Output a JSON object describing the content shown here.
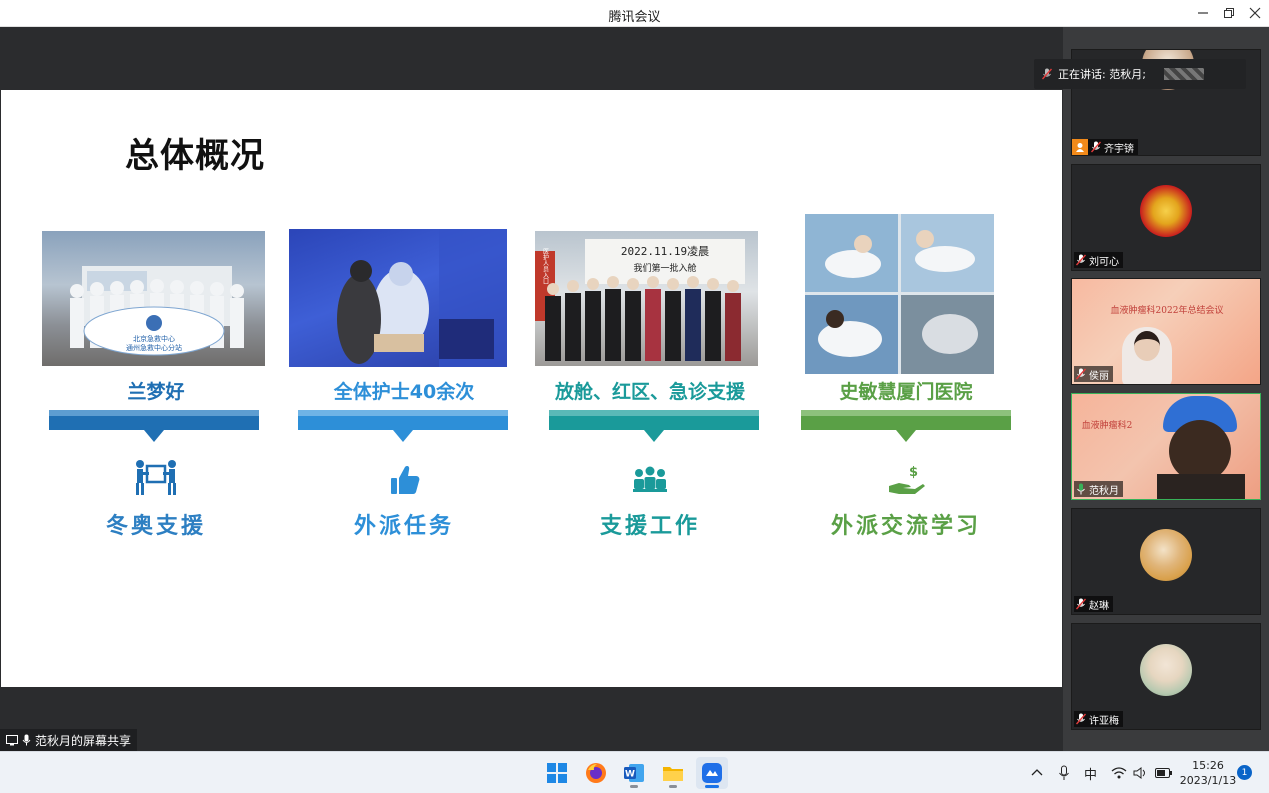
{
  "window": {
    "title": "腾讯会议"
  },
  "slide": {
    "title": "总体概况",
    "columns": [
      {
        "caption": "兰梦好",
        "subtitle": "冬奥支援",
        "color": "#1f6fb3",
        "icon": "people-carry-box-icon"
      },
      {
        "caption": "全体护士40余次",
        "subtitle": "外派任务",
        "color": "#2d8fd8",
        "icon": "thumbs-up-icon"
      },
      {
        "caption": "放舱、红区、急诊支援",
        "subtitle": "支援工作",
        "color": "#1a9a9a",
        "icon": "team-group-icon"
      },
      {
        "caption": "史敏慧厦门医院",
        "subtitle": "外派交流学习",
        "color": "#5aa046",
        "icon": "hand-money-icon"
      }
    ],
    "photo_text": {
      "banner_lines": [
        "北京急救中心",
        "通州急救中心分站"
      ],
      "board_line1": "2022.11.19凌晨",
      "board_line2": "我们第一批入舱",
      "side_sign": "医护人员入口"
    }
  },
  "speaking_banner": {
    "label": "正在讲话: 范秋月;"
  },
  "participants": [
    {
      "name": "齐宇锛",
      "muted": true,
      "active": false
    },
    {
      "name": "刘可心",
      "muted": true,
      "active": false
    },
    {
      "name": "侯丽",
      "muted": true,
      "active": false,
      "video_text": "血液肿瘤科2022年总结会议"
    },
    {
      "name": "范秋月",
      "muted": false,
      "active": true,
      "video_text": "血液肿瘤科2"
    },
    {
      "name": "赵琳",
      "muted": true,
      "active": false
    },
    {
      "name": "许亚梅",
      "muted": true,
      "active": false
    }
  ],
  "share_label": "范秋月的屏幕共享",
  "taskbar": {
    "apps": [
      "windows-start-icon",
      "firefox-icon",
      "word-icon",
      "file-explorer-icon",
      "tencent-meeting-icon"
    ],
    "tray_ime": "中",
    "time": "15:26",
    "date": "2023/1/13",
    "notifications": "1"
  },
  "colors": {
    "bg_dark": "#2b2c2e",
    "active_border": "#38b259",
    "accent": "#1a73e8"
  }
}
